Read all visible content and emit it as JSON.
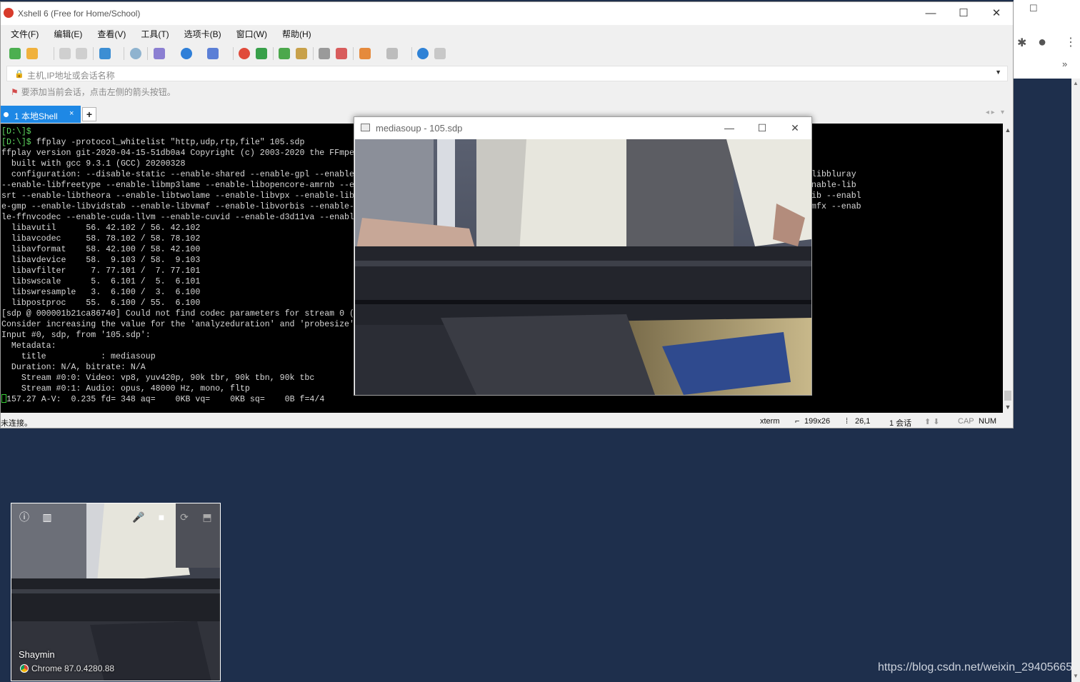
{
  "xshell": {
    "title": "Xshell 6 (Free for Home/School)",
    "menu": [
      "文件(F)",
      "编辑(E)",
      "查看(V)",
      "工具(T)",
      "选项卡(B)",
      "窗口(W)",
      "帮助(H)"
    ],
    "address_placeholder": "主机,IP地址或会话名称",
    "hint": "要添加当前会话，点击左侧的箭头按钮。",
    "tab": {
      "label": "1 本地Shell",
      "close": "×",
      "add": "+"
    },
    "status": {
      "connection": "未连接。",
      "term": "xterm",
      "size": "199x26",
      "cursor": "26,1",
      "sessions": "1 会话",
      "caps": "CAP",
      "num": "NUM"
    },
    "terminal_lines": [
      {
        "prompt": "[D:\\]$",
        "text": ""
      },
      {
        "prompt": "[D:\\]$",
        "text": " ffplay -protocol_whitelist \"http,udp,rtp,file\" 105.sdp"
      },
      {
        "prompt": "",
        "text": "ffplay version git-2020-04-15-51db0a4 Copyright (c) 2003-2020 the FFmpe"
      },
      {
        "prompt": "",
        "text": "  built with gcc 9.3.1 (GCC) 20200328"
      },
      {
        "prompt": "",
        "text": "  configuration: --disable-static --enable-shared --enable-gpl --enable                                                                 --enable-libdav1d --enable-libbluray"
      },
      {
        "prompt": "",
        "text": "--enable-libfreetype --enable-libmp3lame --enable-libopencore-amrnb --e                                                                 snappy --enable-libsoxr --enable-lib"
      },
      {
        "prompt": "",
        "text": "srt --enable-libtheora --enable-libtwolame --enable-libvpx --enable-lib                                                                 g --enable-lzma --enable-zlib --enabl"
      },
      {
        "prompt": "",
        "text": "e-gmp --enable-libvidstab --enable-libvmaf --enable-libvorbis --enable-                                                                 ble-w32threads --enable-libmfx --enab"
      },
      {
        "prompt": "",
        "text": "le-ffnvcodec --enable-cuda-llvm --enable-cuvid --enable-d3d11va --enabl"
      },
      {
        "prompt": "",
        "text": "  libavutil      56. 42.102 / 56. 42.102"
      },
      {
        "prompt": "",
        "text": "  libavcodec     58. 78.102 / 58. 78.102"
      },
      {
        "prompt": "",
        "text": "  libavformat    58. 42.100 / 58. 42.100"
      },
      {
        "prompt": "",
        "text": "  libavdevice    58.  9.103 / 58.  9.103"
      },
      {
        "prompt": "",
        "text": "  libavfilter     7. 77.101 /  7. 77.101"
      },
      {
        "prompt": "",
        "text": "  libswscale      5.  6.101 /  5.  6.101"
      },
      {
        "prompt": "",
        "text": "  libswresample   3.  6.100 /  3.  6.100"
      },
      {
        "prompt": "",
        "text": "  libpostproc    55.  6.100 / 55.  6.100"
      },
      {
        "prompt": "",
        "text": "[sdp @ 000001b21ca86740] Could not find codec parameters for stream 0 ("
      },
      {
        "prompt": "",
        "text": "Consider increasing the value for the 'analyzeduration' and 'probesize'"
      },
      {
        "prompt": "",
        "text": "Input #0, sdp, from '105.sdp':"
      },
      {
        "prompt": "",
        "text": "  Metadata:"
      },
      {
        "prompt": "",
        "text": "    title           : mediasoup"
      },
      {
        "prompt": "",
        "text": "  Duration: N/A, bitrate: N/A"
      },
      {
        "prompt": "",
        "text": "    Stream #0:0: Video: vp8, yuv420p, 90k tbr, 90k tbn, 90k tbc"
      },
      {
        "prompt": "",
        "text": "    Stream #0:1: Audio: opus, 48000 Hz, mono, fltp"
      },
      {
        "prompt": "",
        "text": "157.27 A-V:  0.235 fd= 348 aq=    0KB vq=    0KB sq=    0B f=4/4",
        "cursor": true
      }
    ]
  },
  "ffplay": {
    "title": "mediasoup - 105.sdp"
  },
  "preview": {
    "name": "Shaymin",
    "user_agent": "Chrome 87.0.4280.88"
  },
  "watermark": "https://blog.csdn.net/weixin_29405665",
  "icons": {
    "window_controls": [
      "minimize-icon",
      "maximize-icon",
      "close-icon"
    ],
    "preview_controls": [
      "info-icon",
      "stats-icon",
      "microphone-icon",
      "camera-icon",
      "switch-camera-icon",
      "share-screen-icon"
    ]
  },
  "colors": {
    "desktop": "#1e2f4c",
    "tab_active": "#1e88e5",
    "prompt": "#5fd75f"
  }
}
